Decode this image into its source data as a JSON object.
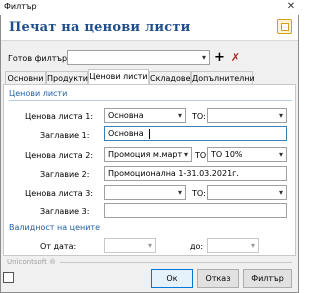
{
  "window": {
    "title": "Филтър",
    "close": "✕"
  },
  "header": {
    "title": "Печат на ценови листи"
  },
  "filter": {
    "label": "Готов филтър:",
    "value": "",
    "add": "+",
    "delete": "✗"
  },
  "tabs": [
    {
      "label": "Основни"
    },
    {
      "label": "Продукти"
    },
    {
      "label": "Ценови листи"
    },
    {
      "label": "Складове"
    },
    {
      "label": "Допълнителни"
    }
  ],
  "active_tab": 2,
  "price_lists": {
    "section": "Ценови листи",
    "pl1": {
      "label": "Ценова листа 1:",
      "value": "Основна",
      "to_label": "ТО:",
      "to_value": ""
    },
    "title1": {
      "label": "Заглавие 1:",
      "value": "Основна"
    },
    "pl2": {
      "label": "Ценова листа 2:",
      "value": "Промоция м.март",
      "to_label": "ТО:",
      "to_value": "ТО 10%"
    },
    "title2": {
      "label": "Заглавие 2:",
      "value": "Промоционална 1-31.03.2021г."
    },
    "pl3": {
      "label": "Ценова листа 3:",
      "value": "",
      "to_label": "ТО:",
      "to_value": ""
    },
    "title3": {
      "label": "Заглавие 3:",
      "value": ""
    }
  },
  "validity": {
    "section": "Валидност на цените",
    "from_label": "От дата:",
    "to_label": "до:"
  },
  "footer": {
    "brand": "Unicontsoft ®",
    "ok": "Ок",
    "cancel": "Отказ",
    "filter": "Филтър"
  }
}
